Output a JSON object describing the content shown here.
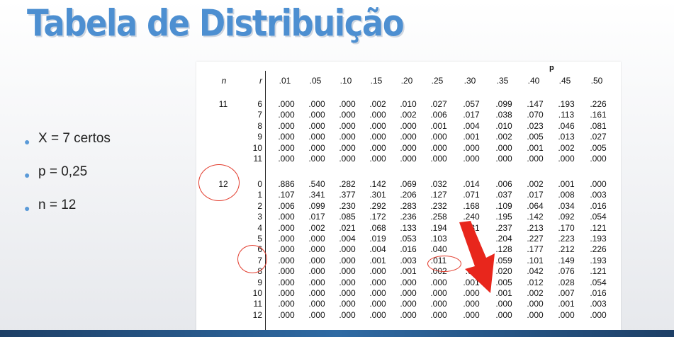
{
  "slide": {
    "title": "Tabela de Distribuição"
  },
  "bullets": [
    "X = 7 certos",
    "p  = 0,25",
    "n = 12"
  ],
  "table": {
    "p_label": "p",
    "n_label": "n",
    "r_label": "r",
    "p_values": [
      ".01",
      ".05",
      ".10",
      ".15",
      ".20",
      ".25",
      ".30",
      ".35",
      ".40",
      ".45",
      ".50"
    ],
    "groups": [
      {
        "n": "11",
        "rows": [
          {
            "r": "6",
            "cells": [
              ".000",
              ".000",
              ".000",
              ".002",
              ".010",
              ".027",
              ".057",
              ".099",
              ".147",
              ".193",
              ".226"
            ]
          },
          {
            "r": "7",
            "cells": [
              ".000",
              ".000",
              ".000",
              ".000",
              ".002",
              ".006",
              ".017",
              ".038",
              ".070",
              ".113",
              ".161"
            ]
          },
          {
            "r": "8",
            "cells": [
              ".000",
              ".000",
              ".000",
              ".000",
              ".000",
              ".001",
              ".004",
              ".010",
              ".023",
              ".046",
              ".081"
            ]
          },
          {
            "r": "9",
            "cells": [
              ".000",
              ".000",
              ".000",
              ".000",
              ".000",
              ".000",
              ".001",
              ".002",
              ".005",
              ".013",
              ".027"
            ]
          },
          {
            "r": "10",
            "cells": [
              ".000",
              ".000",
              ".000",
              ".000",
              ".000",
              ".000",
              ".000",
              ".000",
              ".001",
              ".002",
              ".005"
            ]
          },
          {
            "r": "11",
            "cells": [
              ".000",
              ".000",
              ".000",
              ".000",
              ".000",
              ".000",
              ".000",
              ".000",
              ".000",
              ".000",
              ".000"
            ]
          }
        ]
      },
      {
        "n": "12",
        "rows": [
          {
            "r": "0",
            "cells": [
              ".886",
              ".540",
              ".282",
              ".142",
              ".069",
              ".032",
              ".014",
              ".006",
              ".002",
              ".001",
              ".000"
            ]
          },
          {
            "r": "1",
            "cells": [
              ".107",
              ".341",
              ".377",
              ".301",
              ".206",
              ".127",
              ".071",
              ".037",
              ".017",
              ".008",
              ".003"
            ]
          },
          {
            "r": "2",
            "cells": [
              ".006",
              ".099",
              ".230",
              ".292",
              ".283",
              ".232",
              ".168",
              ".109",
              ".064",
              ".034",
              ".016"
            ]
          },
          {
            "r": "3",
            "cells": [
              ".000",
              ".017",
              ".085",
              ".172",
              ".236",
              ".258",
              ".240",
              ".195",
              ".142",
              ".092",
              ".054"
            ]
          },
          {
            "r": "4",
            "cells": [
              ".000",
              ".002",
              ".021",
              ".068",
              ".133",
              ".194",
              ".231",
              ".237",
              ".213",
              ".170",
              ".121"
            ]
          },
          {
            "r": "5",
            "cells": [
              ".000",
              ".000",
              ".004",
              ".019",
              ".053",
              ".103",
              "",
              ".204",
              ".227",
              ".223",
              ".193"
            ]
          },
          {
            "r": "6",
            "cells": [
              ".000",
              ".000",
              ".000",
              ".004",
              ".016",
              ".040",
              "",
              ".128",
              ".177",
              ".212",
              ".226"
            ]
          },
          {
            "r": "7",
            "cells": [
              ".000",
              ".000",
              ".000",
              ".001",
              ".003",
              ".011",
              "",
              ".059",
              ".101",
              ".149",
              ".193"
            ]
          },
          {
            "r": "8",
            "cells": [
              ".000",
              ".000",
              ".000",
              ".000",
              ".001",
              ".002",
              ".00",
              ".020",
              ".042",
              ".076",
              ".121"
            ]
          },
          {
            "r": "9",
            "cells": [
              ".000",
              ".000",
              ".000",
              ".000",
              ".000",
              ".000",
              ".001",
              ".005",
              ".012",
              ".028",
              ".054"
            ]
          },
          {
            "r": "10",
            "cells": [
              ".000",
              ".000",
              ".000",
              ".000",
              ".000",
              ".000",
              ".000",
              ".001",
              ".002",
              ".007",
              ".016"
            ]
          },
          {
            "r": "11",
            "cells": [
              ".000",
              ".000",
              ".000",
              ".000",
              ".000",
              ".000",
              ".000",
              ".000",
              ".000",
              ".001",
              ".003"
            ]
          },
          {
            "r": "12",
            "cells": [
              ".000",
              ".000",
              ".000",
              ".000",
              ".000",
              ".000",
              ".000",
              ".000",
              ".000",
              ".000",
              ".000"
            ]
          }
        ]
      }
    ]
  },
  "annotations": {
    "circles": [
      "n-12",
      "r-6-7",
      "value-011"
    ],
    "arrow_icon": "red-arrow",
    "accent_color": "#e23b2c",
    "title_color": "#4d8fd1"
  }
}
